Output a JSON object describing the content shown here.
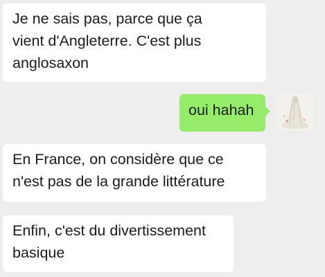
{
  "messages": [
    {
      "direction": "incoming",
      "lines": [
        "Je ne sais pas, parce que ça",
        "vient d'Angleterre. C'est plus",
        "anglosaxon"
      ]
    },
    {
      "direction": "outgoing",
      "lines": [
        "oui hahah"
      ],
      "avatar_icon": "user-avatar-icon"
    },
    {
      "direction": "incoming",
      "lines": [
        "En France, on considère que ce",
        "n'est pas de la grande littérature"
      ]
    },
    {
      "direction": "incoming",
      "lines": [
        "Enfin, c'est du divertissement",
        "basique"
      ]
    }
  ],
  "colors": {
    "background": "#ededed",
    "incoming_bubble": "#ffffff",
    "outgoing_bubble": "#95ec69",
    "text": "#1b1b1b"
  }
}
